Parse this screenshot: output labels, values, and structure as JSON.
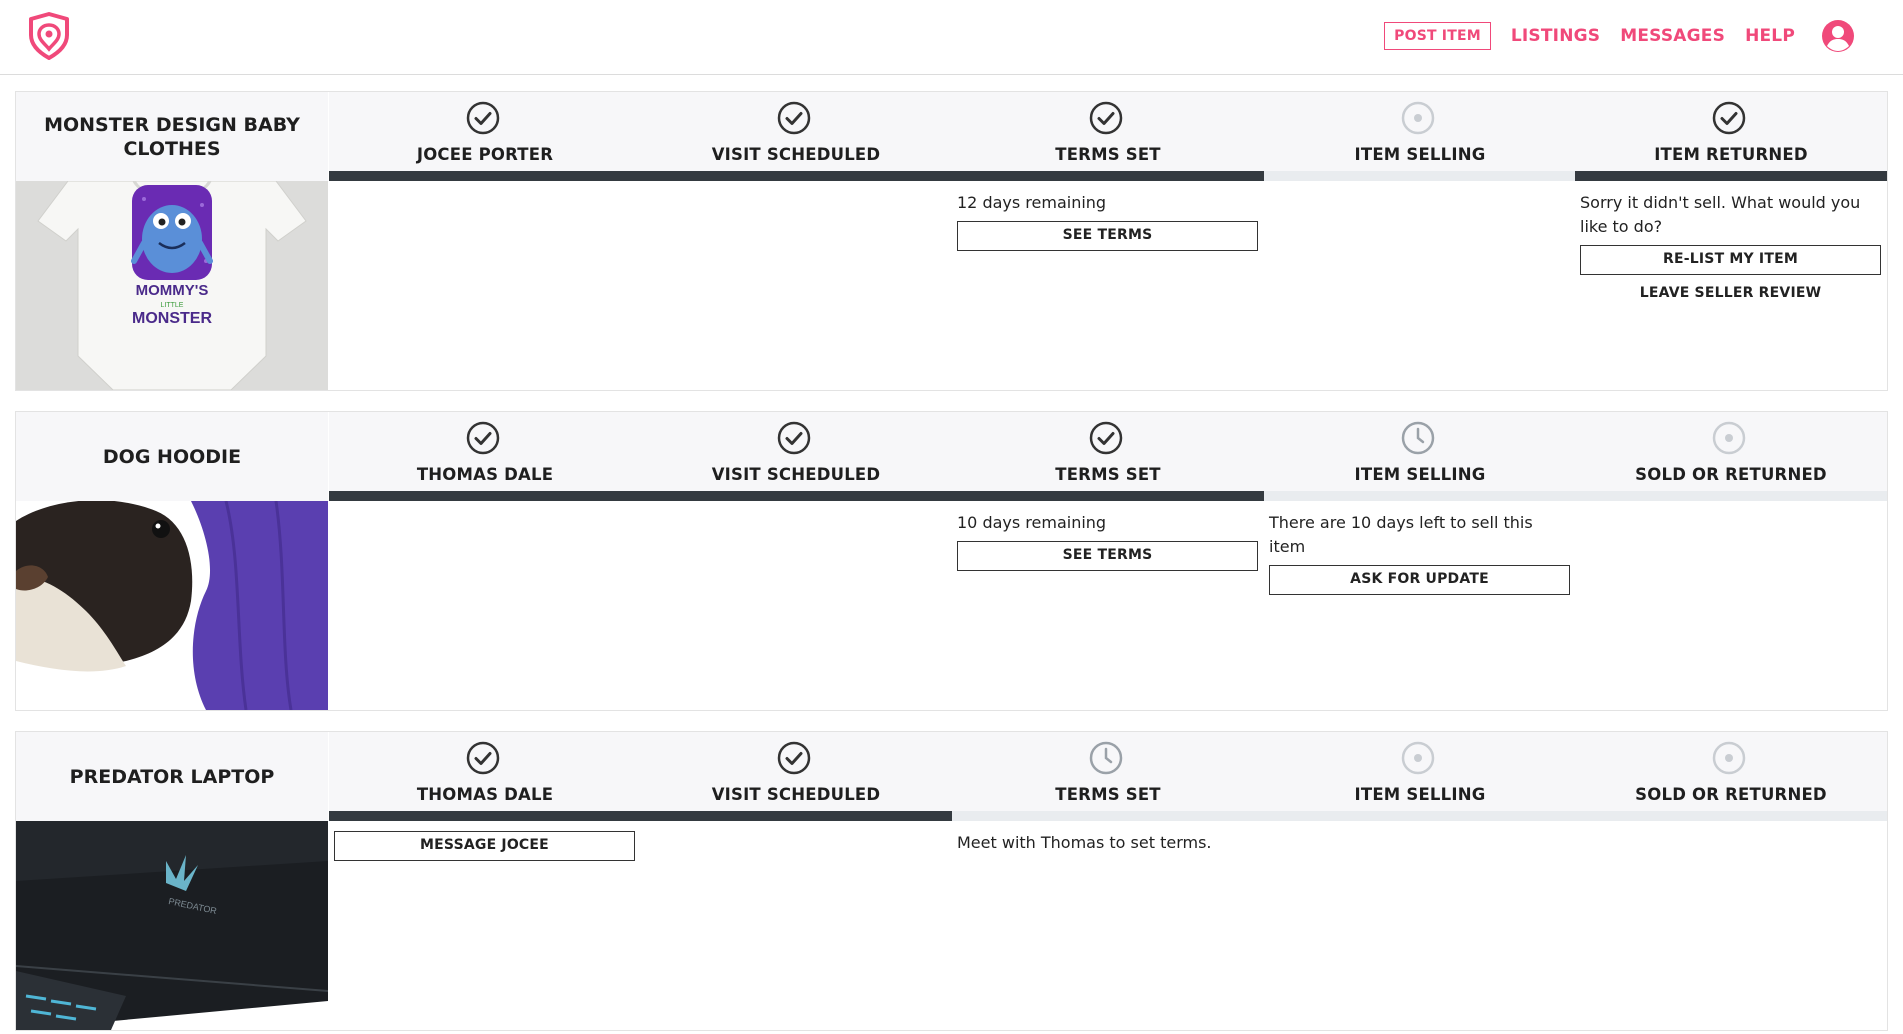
{
  "header": {
    "post_item": "POST ITEM",
    "links": [
      "LISTINGS",
      "MESSAGES",
      "HELP"
    ],
    "brand_color": "#f0497a"
  },
  "listings": [
    {
      "title": "MONSTER DESIGN BABY CLOTHES",
      "photo": "baby-onesie-photo",
      "photo_text": [
        "MOMMY'S",
        "LITTLE",
        "MONSTER"
      ],
      "steps": [
        {
          "label": "JOCEE PORTER",
          "icon": "check-circle-icon",
          "progress": "complete"
        },
        {
          "label": "VISIT SCHEDULED",
          "icon": "check-circle-icon",
          "progress": "complete"
        },
        {
          "label": "TERMS SET",
          "icon": "check-circle-icon",
          "progress": "complete",
          "text": "12 days remaining",
          "button": "SEE TERMS"
        },
        {
          "label": "ITEM SELLING",
          "icon": "dot-circle-icon",
          "progress": "pending"
        },
        {
          "label": "ITEM RETURNED",
          "icon": "check-circle-icon",
          "progress": "complete",
          "text": "Sorry it didn't sell. What would you like to do?",
          "button": "RE-LIST MY ITEM",
          "link": "LEAVE SELLER REVIEW"
        }
      ]
    },
    {
      "title": "DOG HOODIE",
      "photo": "dog-hoodie-photo",
      "steps": [
        {
          "label": "THOMAS DALE",
          "icon": "check-circle-icon",
          "progress": "complete"
        },
        {
          "label": "VISIT SCHEDULED",
          "icon": "check-circle-icon",
          "progress": "complete"
        },
        {
          "label": "TERMS SET",
          "icon": "check-circle-icon",
          "progress": "complete",
          "text": "10 days remaining",
          "button": "SEE TERMS"
        },
        {
          "label": "ITEM SELLING",
          "icon": "clock-icon",
          "progress": "pending",
          "text": "There are 10 days left to sell this item",
          "button": "ASK FOR UPDATE"
        },
        {
          "label": "SOLD OR RETURNED",
          "icon": "dot-circle-icon",
          "progress": "pending"
        }
      ]
    },
    {
      "title": "PREDATOR LAPTOP",
      "photo": "laptop-photo",
      "photo_text": [
        "PREDATOR"
      ],
      "steps": [
        {
          "label": "THOMAS DALE",
          "icon": "check-circle-icon",
          "progress": "complete",
          "button": "MESSAGE JOCEE"
        },
        {
          "label": "VISIT SCHEDULED",
          "icon": "check-circle-icon",
          "progress": "complete"
        },
        {
          "label": "TERMS SET",
          "icon": "clock-icon",
          "progress": "pending",
          "text": "Meet with Thomas to set terms."
        },
        {
          "label": "ITEM SELLING",
          "icon": "dot-circle-icon",
          "progress": "pending"
        },
        {
          "label": "SOLD OR RETURNED",
          "icon": "dot-circle-icon",
          "progress": "pending"
        }
      ]
    }
  ]
}
